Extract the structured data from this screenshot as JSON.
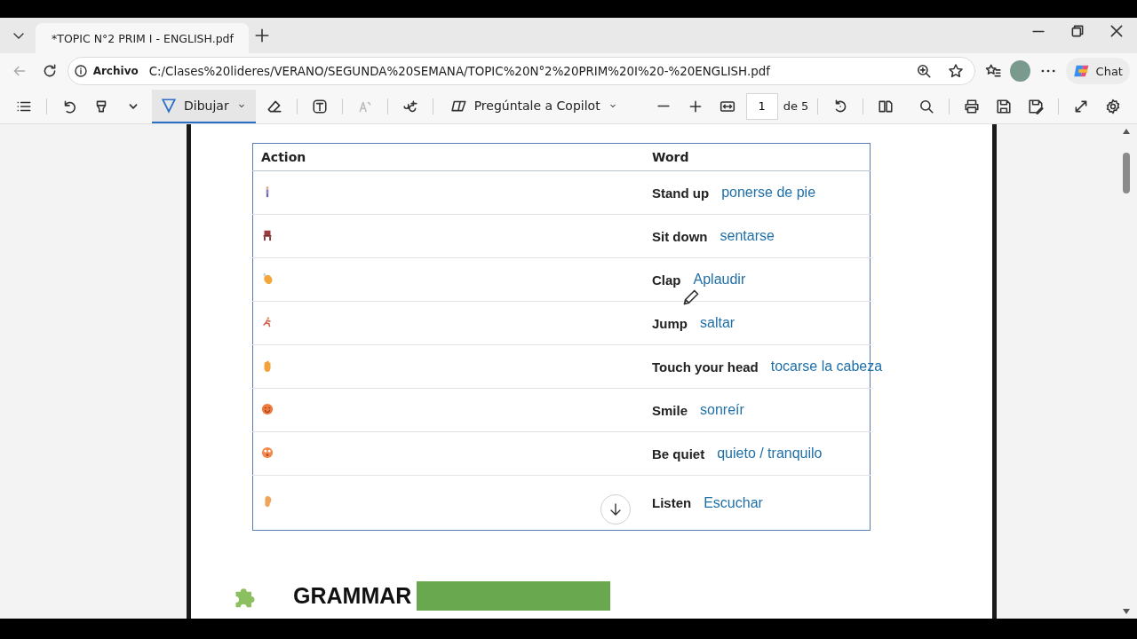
{
  "browser": {
    "tabs": [
      {
        "title": "*TOPIC N°2 PRIM I - ENGLISH.pdf",
        "selected": true
      }
    ],
    "address_bar": {
      "scheme_label": "Archivo",
      "url": "C:/Clases%20lideres/VERANO/SEGUNDA%20SEMANA/TOPIC%20N°2%20PRIM%20I%20-%20ENGLISH.pdf"
    },
    "chat_button": "Chat"
  },
  "pdf_toolbar": {
    "draw_button": {
      "label": "Dibujar",
      "selected": true
    },
    "copilot_button": "Pregúntale a Copilot",
    "page_number": "1",
    "page_total": "de 5"
  },
  "table": {
    "columns": [
      "Action",
      "Word"
    ],
    "rows": [
      {
        "word": "Stand up",
        "translation": "ponerse de pie"
      },
      {
        "word": "Sit down",
        "translation": "sentarse"
      },
      {
        "word": "Clap",
        "translation": "Aplaudir"
      },
      {
        "word": "Jump",
        "translation": "saltar"
      },
      {
        "word": "Touch your head",
        "translation": "tocarse la cabeza"
      },
      {
        "word": "Smile",
        "translation": "sonreír"
      },
      {
        "word": "Be quiet",
        "translation": "quieto / tranquilo"
      },
      {
        "word": "Listen",
        "translation": "Escuchar"
      }
    ]
  },
  "section_heading": "GRAMMAR"
}
